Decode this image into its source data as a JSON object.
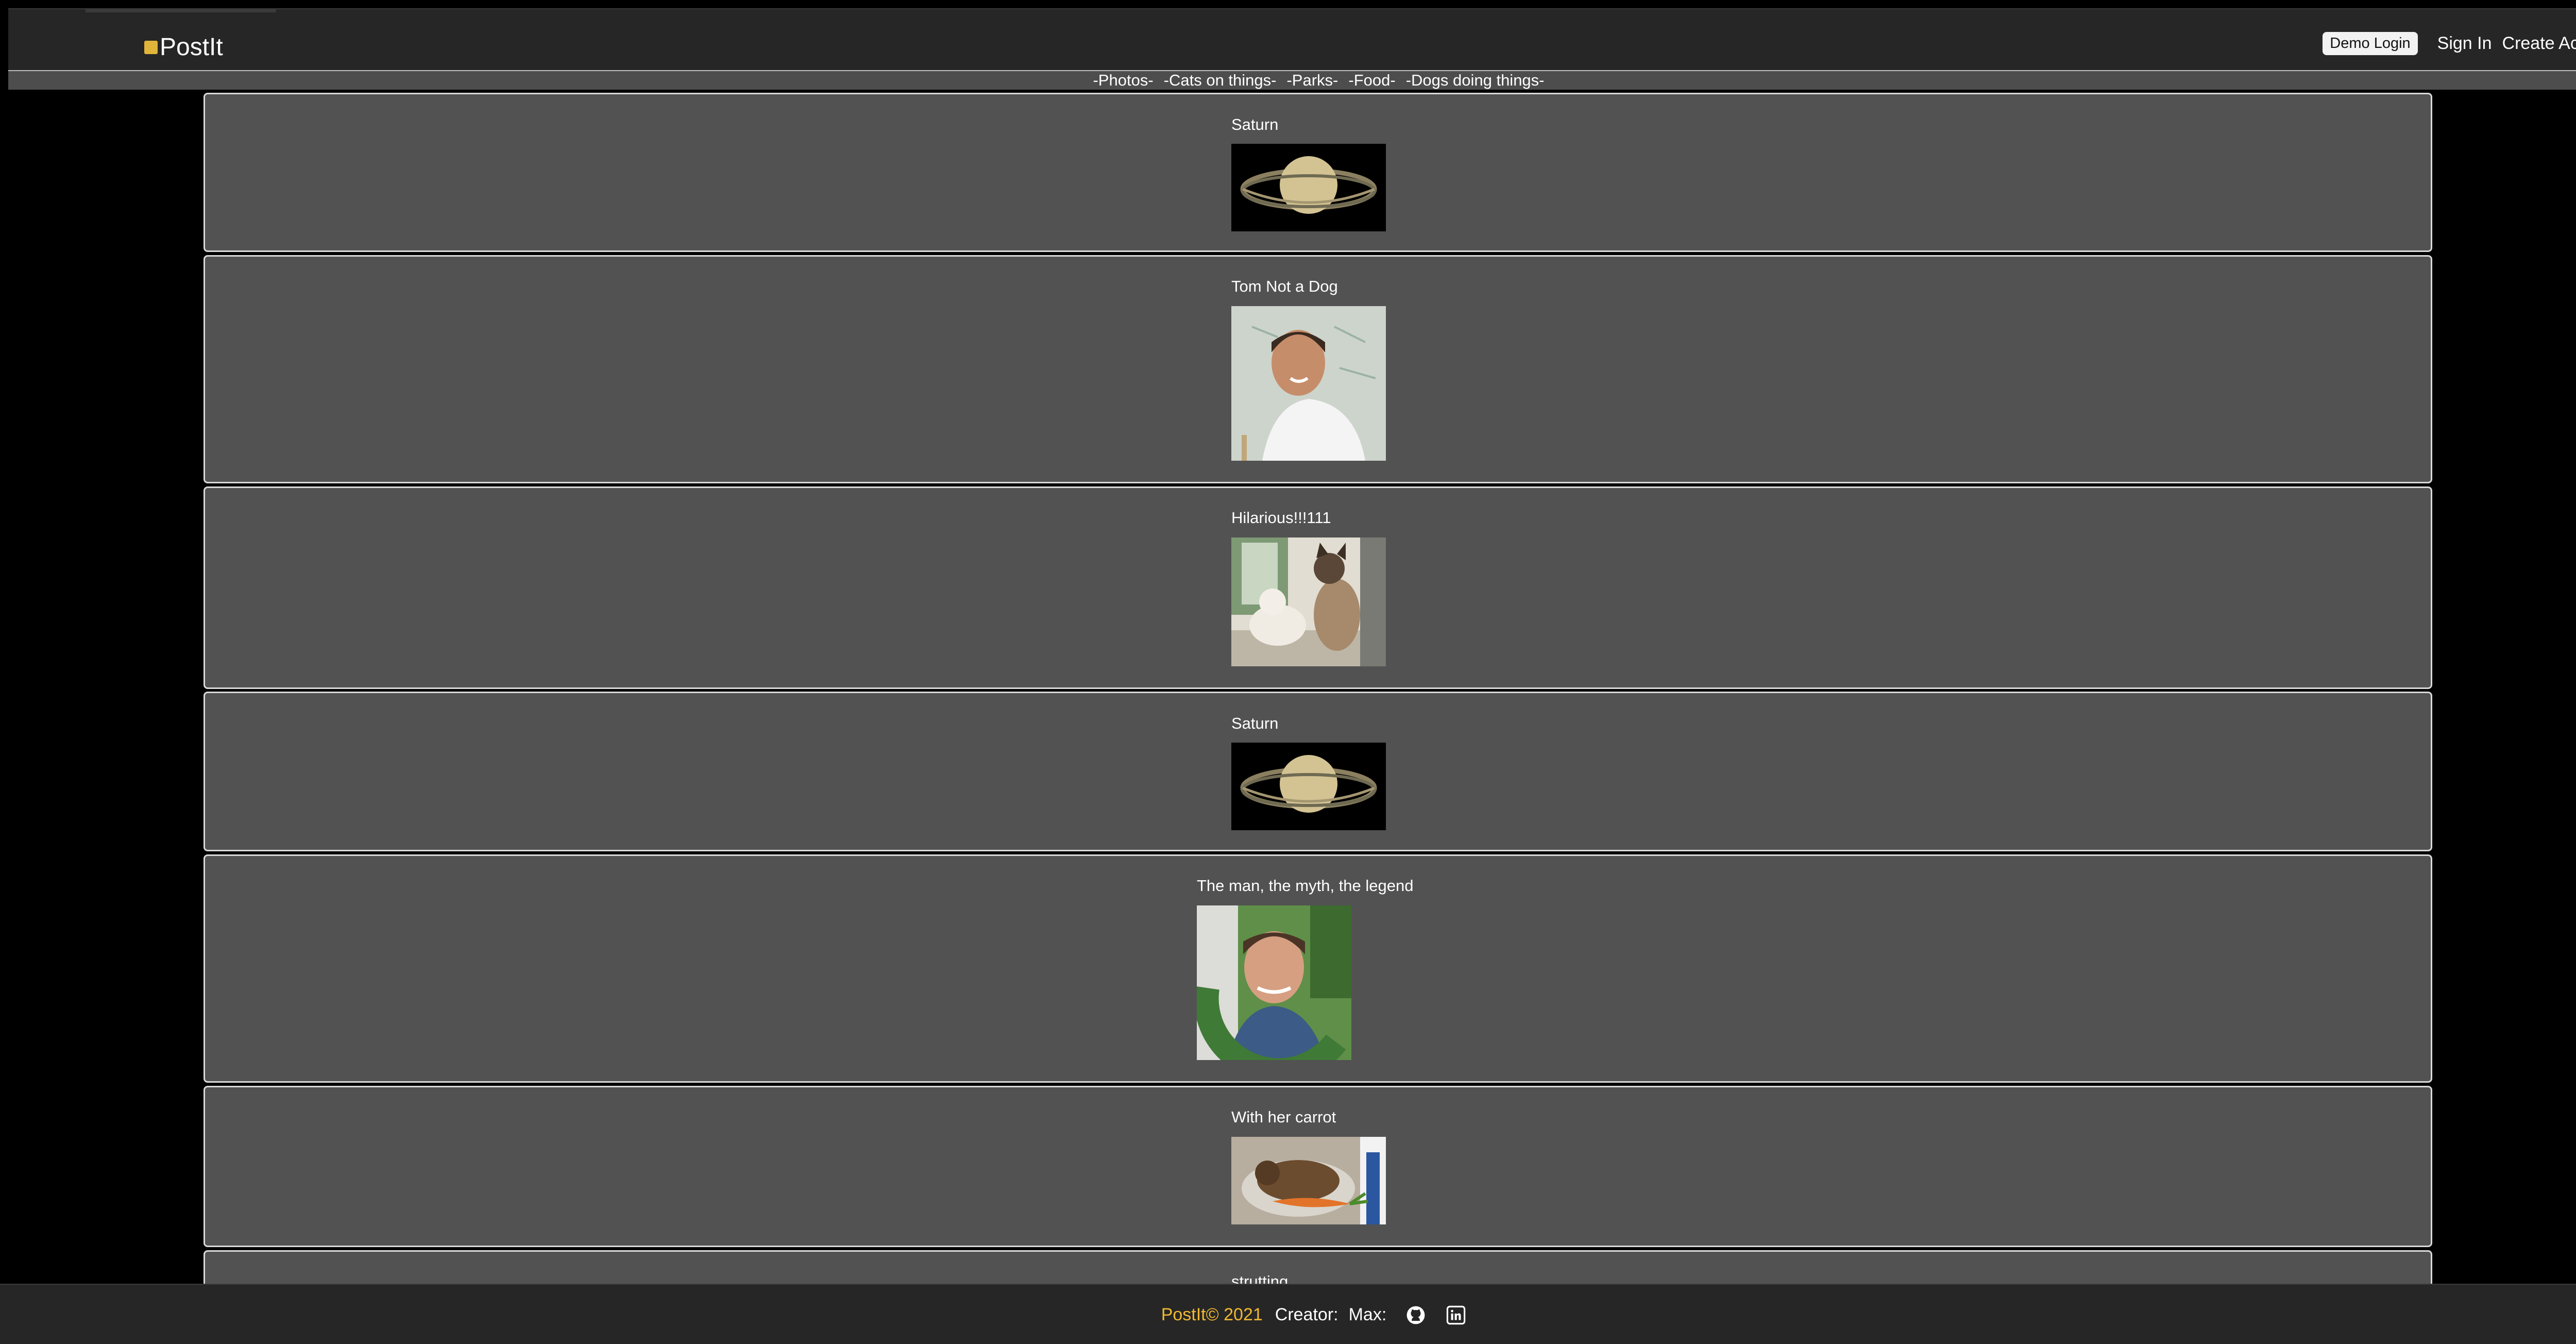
{
  "header": {
    "logo_text": "PostIt",
    "demo_login_label": "Demo Login",
    "sign_in_label": "Sign In",
    "create_account_label": "Create Account"
  },
  "categories": [
    "-Photos-",
    "-Cats on things-",
    "-Parks-",
    "-Food-",
    "-Dogs doing things-"
  ],
  "posts": [
    {
      "title": "Saturn",
      "image_icon": "saturn-photo"
    },
    {
      "title": "Tom Not a Dog",
      "image_icon": "portrait-photo"
    },
    {
      "title": "Hilarious!!!111",
      "image_icon": "cats-photo"
    },
    {
      "title": "Saturn",
      "image_icon": "saturn-photo"
    },
    {
      "title": "The man, the myth, the legend",
      "image_icon": "portrait-photo"
    },
    {
      "title": "With her carrot",
      "image_icon": "cat-carrot-photo"
    },
    {
      "title": "strutting",
      "image_icon": "photo"
    }
  ],
  "footer": {
    "copyright": "PostIt© 2021",
    "creator_label": "Creator:",
    "max_label": "Max:",
    "github_icon": "github-icon",
    "linkedin_icon": "linkedin-icon"
  },
  "colors": {
    "background": "#000000",
    "header": "#262626",
    "card": "#525252",
    "accent": "#f0b832"
  }
}
